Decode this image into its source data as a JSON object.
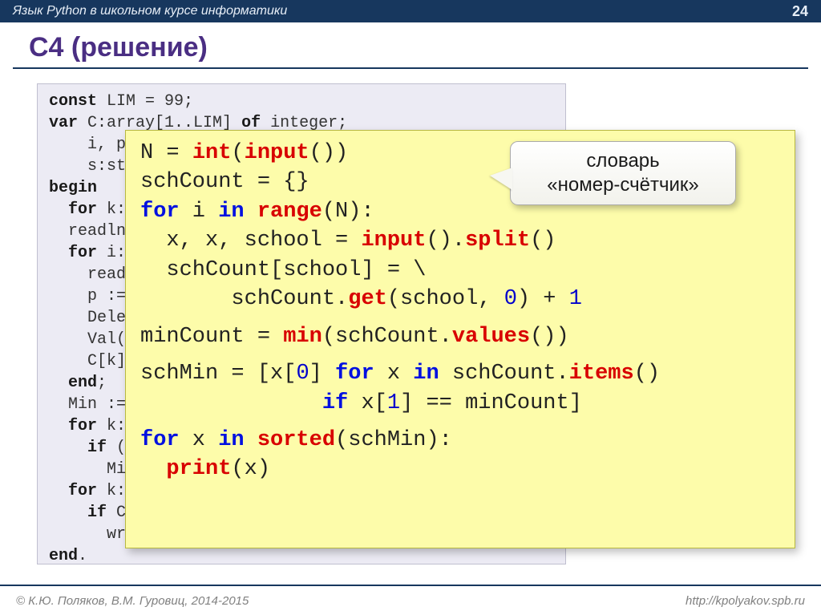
{
  "header": {
    "title": "Язык Python в школьном курсе информатики",
    "page": "24"
  },
  "heading": "C4 (решение)",
  "pascal": {
    "lines": [
      {
        "t": "const LIM = 99;",
        "bold": [
          "const"
        ]
      },
      {
        "t": "var C:array[1..LIM] of integer;",
        "bold": [
          "var",
          "of"
        ]
      },
      {
        "t": "    i, p,",
        "bold": []
      },
      {
        "t": "    s:stri",
        "bold": []
      },
      {
        "t": "begin",
        "bold": [
          "begin"
        ]
      },
      {
        "t": "  for k:",
        "bold": [
          "for"
        ]
      },
      {
        "t": "  readln",
        "bold": []
      },
      {
        "t": "  for i:",
        "bold": [
          "for"
        ]
      },
      {
        "t": "    read",
        "bold": []
      },
      {
        "t": "    p :=",
        "bold": []
      },
      {
        "t": "    Dele",
        "bold": []
      },
      {
        "t": "    Val(",
        "bold": []
      },
      {
        "t": "    C[k]",
        "bold": []
      },
      {
        "t": "  end;",
        "bold": [
          "end"
        ]
      },
      {
        "t": "  Min :=",
        "bold": []
      },
      {
        "t": "  for k:",
        "bold": [
          "for"
        ]
      },
      {
        "t": "    if (",
        "bold": [
          "if"
        ]
      },
      {
        "t": "      Mi",
        "bold": []
      },
      {
        "t": "  for k:",
        "bold": [
          "for"
        ]
      },
      {
        "t": "    if C",
        "bold": [
          "if"
        ]
      },
      {
        "t": "      wr",
        "bold": []
      },
      {
        "t": "end.",
        "bold": [
          "end"
        ]
      }
    ]
  },
  "python": {
    "tokens": [
      [
        [
          "N = ",
          "p"
        ],
        [
          "int",
          "fn"
        ],
        [
          "(",
          "p"
        ],
        [
          "input",
          "fn"
        ],
        [
          "())",
          "p"
        ]
      ],
      [
        [
          "schCount = {}",
          "p"
        ]
      ],
      [
        [
          "for",
          "kw"
        ],
        [
          " i ",
          "p"
        ],
        [
          "in",
          "kw"
        ],
        [
          " ",
          "p"
        ],
        [
          "range",
          "fn"
        ],
        [
          "(N):",
          "p"
        ]
      ],
      [
        [
          "  x, x, school = ",
          "p"
        ],
        [
          "input",
          "fn"
        ],
        [
          "().",
          "p"
        ],
        [
          "split",
          "fn"
        ],
        [
          "()",
          "p"
        ]
      ],
      [
        [
          "  schCount[school] = \\",
          "p"
        ]
      ],
      [
        [
          "       schCount.",
          "p"
        ],
        [
          "get",
          "fn"
        ],
        [
          "(school, ",
          "p"
        ],
        [
          "0",
          "num"
        ],
        [
          ") + ",
          "p"
        ],
        [
          "1",
          "num"
        ]
      ],
      [
        [
          "minCount = ",
          "p"
        ],
        [
          "min",
          "fn"
        ],
        [
          "(schCount.",
          "p"
        ],
        [
          "values",
          "fn"
        ],
        [
          "())",
          "p"
        ]
      ],
      [
        [
          "schMin = [x[",
          "p"
        ],
        [
          "0",
          "num"
        ],
        [
          "] ",
          "p"
        ],
        [
          "for",
          "kw"
        ],
        [
          " x ",
          "p"
        ],
        [
          "in",
          "kw"
        ],
        [
          " schCount.",
          "p"
        ],
        [
          "items",
          "fn"
        ],
        [
          "()",
          "p"
        ]
      ],
      [
        [
          "              ",
          "p"
        ],
        [
          "if",
          "kw"
        ],
        [
          " x[",
          "p"
        ],
        [
          "1",
          "num"
        ],
        [
          "] == minCount]",
          "p"
        ]
      ],
      [
        [
          "for",
          "kw"
        ],
        [
          " x ",
          "p"
        ],
        [
          "in",
          "kw"
        ],
        [
          " ",
          "p"
        ],
        [
          "sorted",
          "fn"
        ],
        [
          "(schMin):",
          "p"
        ]
      ],
      [
        [
          "  ",
          "p"
        ],
        [
          "print",
          "fn"
        ],
        [
          "(x)",
          "p"
        ]
      ]
    ],
    "blank_after": [
      5,
      6,
      8
    ]
  },
  "callout": "словарь\n«номер-счётчик»",
  "footer": {
    "left": "© К.Ю. Поляков, В.М. Гуровиц, 2014-2015",
    "right": "http://kpolyakov.spb.ru"
  }
}
